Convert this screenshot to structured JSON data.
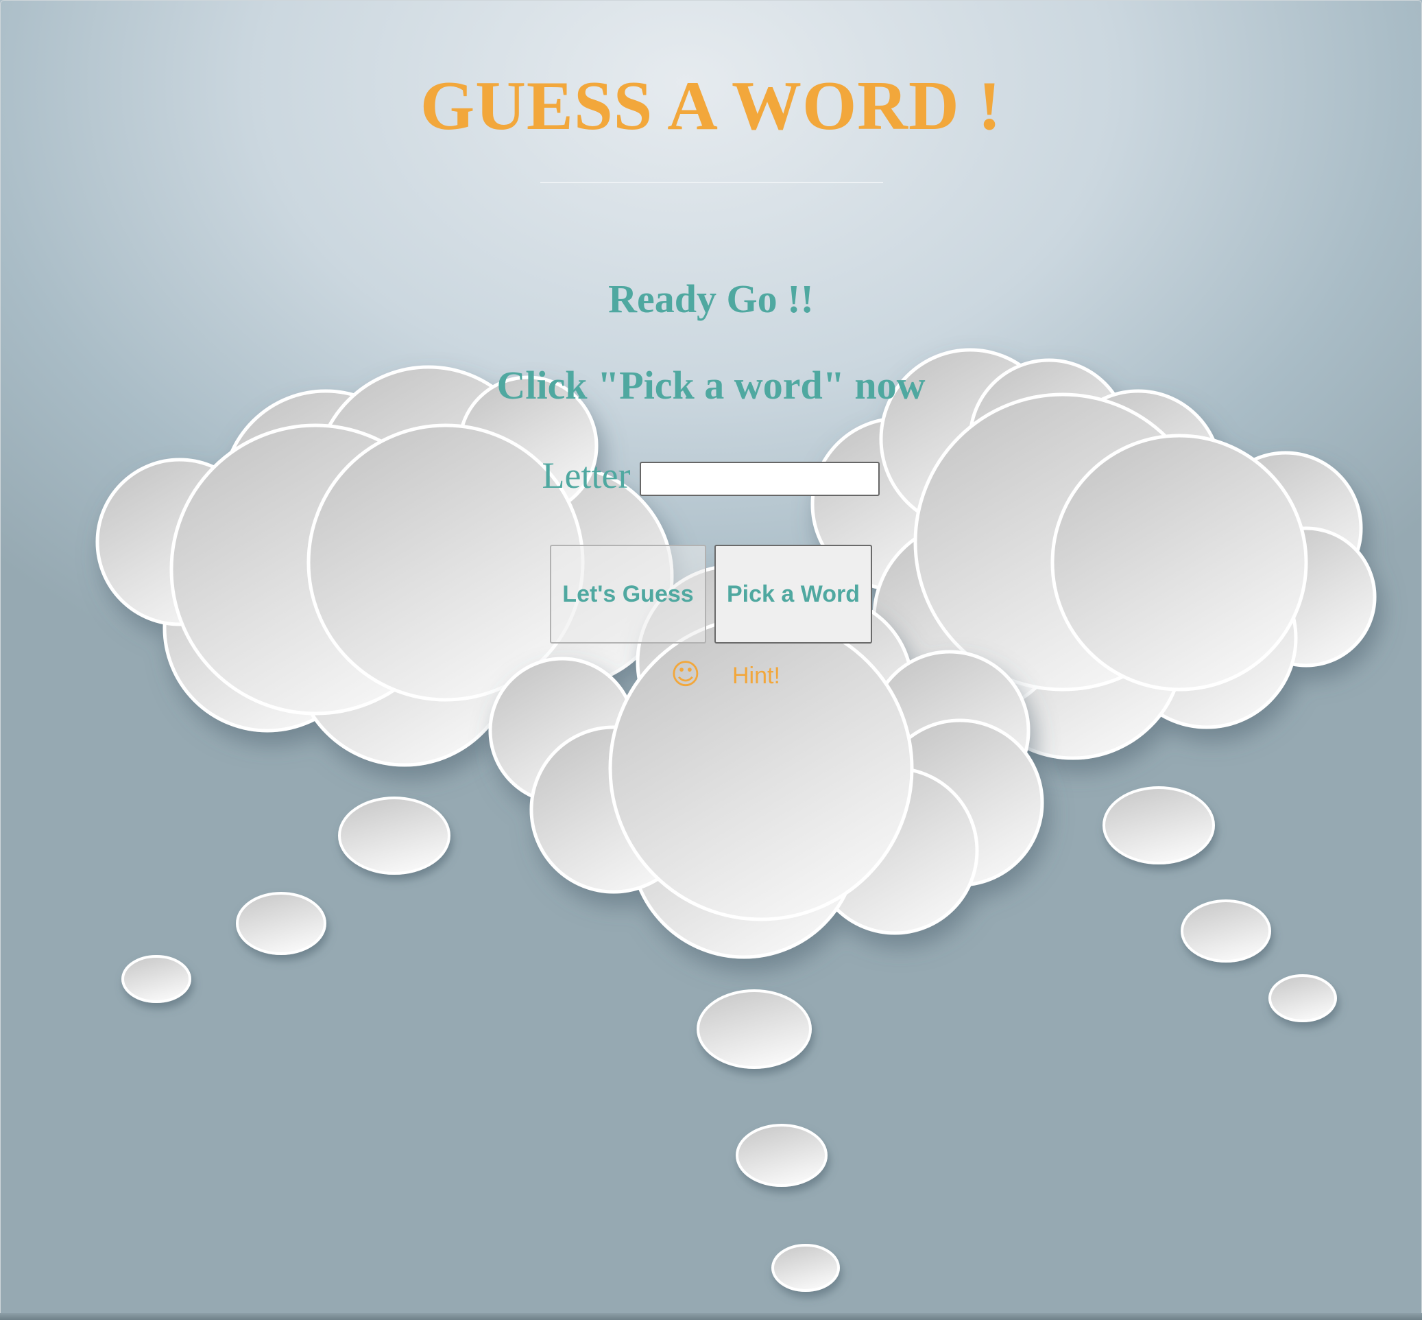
{
  "title": "GUESS A WORD !",
  "messages": {
    "ready": "Ready Go !!",
    "instruction": "Click \"Pick a word\" now"
  },
  "letter_input": {
    "label": "Letter",
    "value": "",
    "placeholder": ""
  },
  "buttons": {
    "guess": "Let's Guess",
    "pick": "Pick a Word"
  },
  "hint": {
    "icon": "smiley-icon",
    "glyph": "☺",
    "label": "Hint!"
  },
  "colors": {
    "title": "#f2a73b",
    "text": "#4fa8a0",
    "hint": "#f2a73b"
  }
}
